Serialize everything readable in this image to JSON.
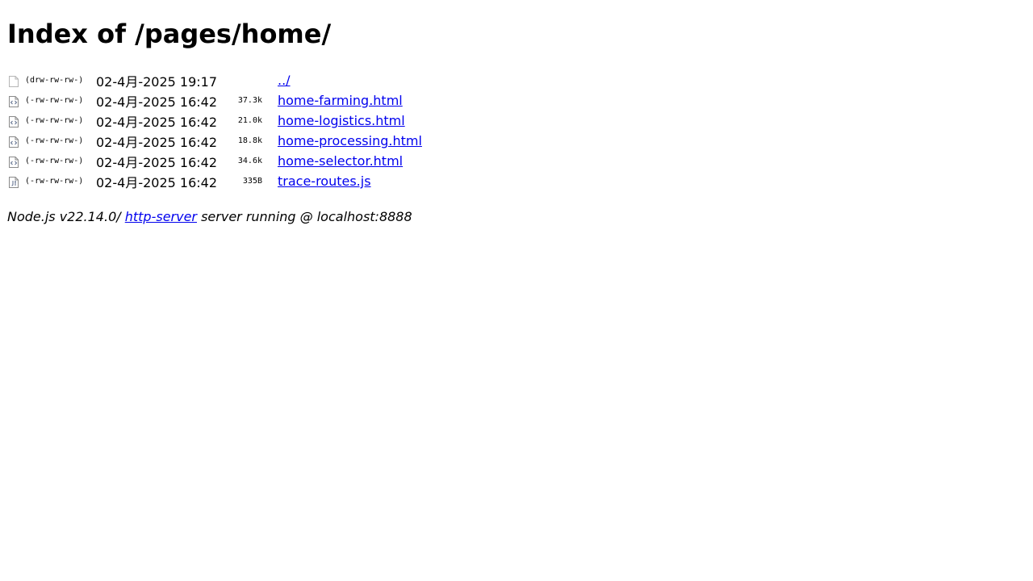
{
  "page": {
    "title": "Index of /pages/home/"
  },
  "listing": [
    {
      "icon": "folder-icon",
      "perms": "(drw-rw-rw-)",
      "date": "02-4月-2025 19:17",
      "size": "",
      "name": "../"
    },
    {
      "icon": "html-file-icon",
      "perms": "(-rw-rw-rw-)",
      "date": "02-4月-2025 16:42",
      "size": "37.3k",
      "name": "home-farming.html"
    },
    {
      "icon": "html-file-icon",
      "perms": "(-rw-rw-rw-)",
      "date": "02-4月-2025 16:42",
      "size": "21.0k",
      "name": "home-logistics.html"
    },
    {
      "icon": "html-file-icon",
      "perms": "(-rw-rw-rw-)",
      "date": "02-4月-2025 16:42",
      "size": "18.8k",
      "name": "home-processing.html"
    },
    {
      "icon": "html-file-icon",
      "perms": "(-rw-rw-rw-)",
      "date": "02-4月-2025 16:42",
      "size": "34.6k",
      "name": "home-selector.html"
    },
    {
      "icon": "js-file-icon",
      "perms": "(-rw-rw-rw-)",
      "date": "02-4月-2025 16:42",
      "size": "335B",
      "name": "trace-routes.js"
    }
  ],
  "footer": {
    "prefix": "Node.js v22.14.0/ ",
    "link_label": "http-server",
    "suffix": " server running @ localhost:8888"
  },
  "colors": {
    "link": "#0000ee",
    "text": "#000000",
    "background": "#ffffff"
  }
}
